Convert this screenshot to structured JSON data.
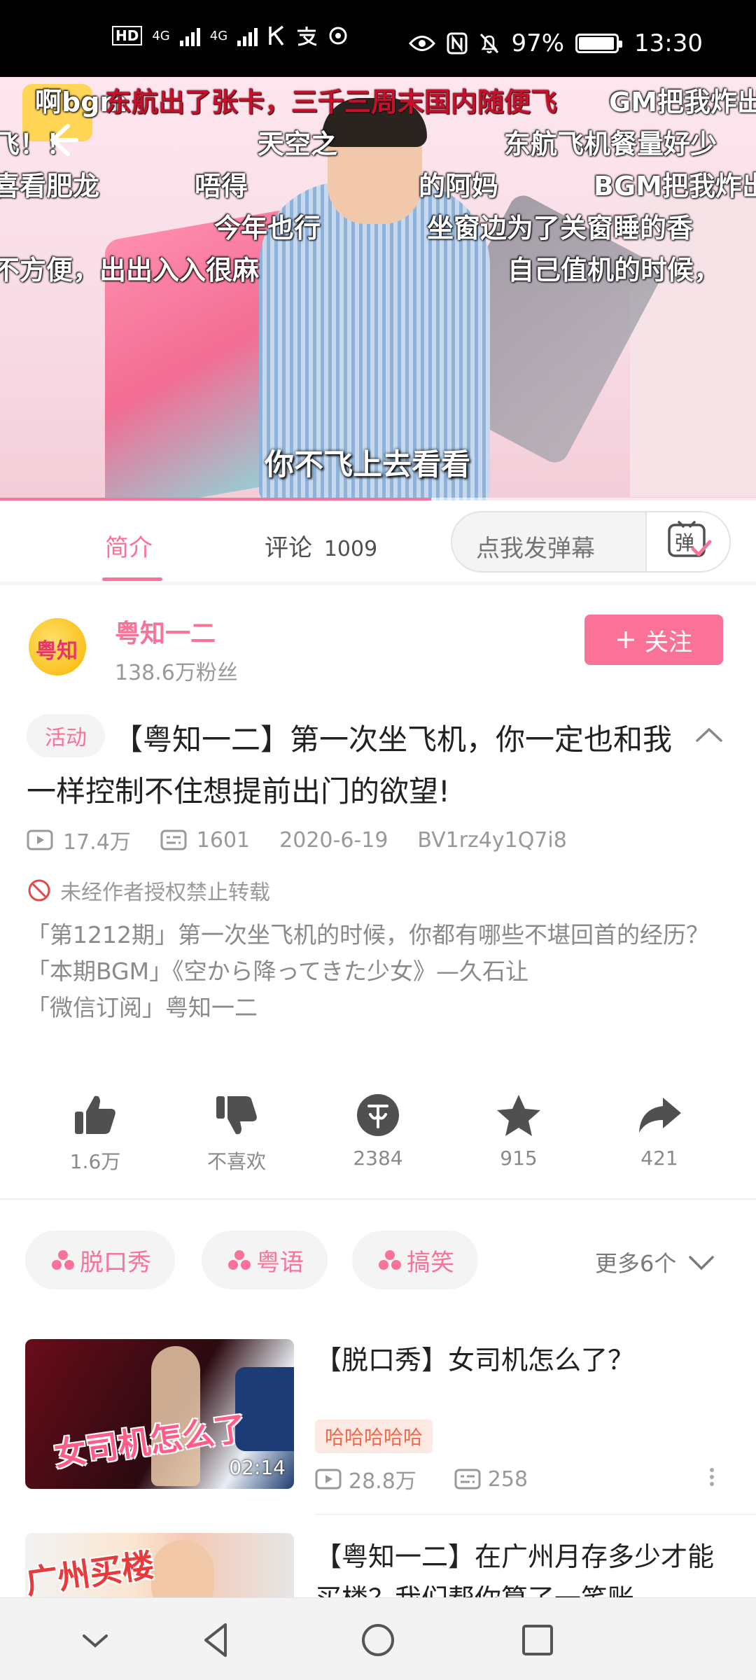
{
  "status_bar": {
    "network_labels": [
      "HD",
      "4G",
      "4G"
    ],
    "battery_percent": "97%",
    "battery_level": 0.97,
    "time": "13:30",
    "icons": [
      "hd-icon",
      "signal-icon",
      "k-icon",
      "alipay-icon",
      "location-icon",
      "eye-icon",
      "nfc-icon",
      "mute-icon",
      "battery-icon"
    ]
  },
  "video": {
    "danmaku": [
      {
        "text": "啊bgm",
        "color": "#ffffff"
      },
      {
        "text": "东航出了张卡，三千三周末国内随便飞",
        "color": "#c4102c"
      },
      {
        "text": "GM把我炸出",
        "color": "#ffffff"
      },
      {
        "text": "飞！！",
        "color": "#ffffff"
      },
      {
        "text": "天空之",
        "color": "#ffffff"
      },
      {
        "text": "东航飞机餐量好少",
        "color": "#ffffff"
      },
      {
        "text": "喜看肥龙",
        "color": "#ffffff"
      },
      {
        "text": "唔得",
        "color": "#ffffff"
      },
      {
        "text": "的阿妈",
        "color": "#ffffff"
      },
      {
        "text": "BGM把我炸出",
        "color": "#ffffff"
      },
      {
        "text": "今年也行",
        "color": "#ffffff"
      },
      {
        "text": "坐窗边为了关窗睡的香",
        "color": "#ffffff"
      },
      {
        "text": "不方便，出出入入很麻",
        "color": "#ffffff"
      },
      {
        "text": "自己值机的时候，",
        "color": "#ffffff"
      }
    ],
    "subtitle": "你不飞上去看看",
    "progress": 0.57,
    "accent": "#fb7299"
  },
  "tabs": {
    "intro": "简介",
    "comments": "评论",
    "comment_count": "1009",
    "danmu_placeholder": "点我发弹幕",
    "danmu_button_icon": "danmaku-toggle-icon",
    "danmu_button_glyph": "弹"
  },
  "uploader": {
    "name": "粤知一二",
    "fans": "138.6万粉丝",
    "follow_label": "关注",
    "avatar_text": "粤知"
  },
  "video_info": {
    "tag": "活动",
    "title": "【粤知一二】第一次坐飞机，你一定也和我一样控制不住想提前出门的欲望!",
    "views": "17.4万",
    "danmaku_count": "1601",
    "date": "2020-6-19",
    "bvid": "BV1rz4y1Q7i8",
    "no_repost": "未经作者授权禁止转载",
    "description": [
      "「第1212期」第一次坐飞机的时候，你都有哪些不堪回首的经历？",
      "「本期BGM」《空から降ってきた少女》—久石让",
      "「微信订阅」粤知一二"
    ]
  },
  "actions": [
    {
      "icon": "like-icon",
      "label": "1.6万"
    },
    {
      "icon": "dislike-icon",
      "label": "不喜欢"
    },
    {
      "icon": "coin-icon",
      "label": "2384"
    },
    {
      "icon": "favorite-icon",
      "label": "915"
    },
    {
      "icon": "share-icon",
      "label": "421"
    }
  ],
  "tags": {
    "items": [
      "脱口秀",
      "粤语",
      "搞笑"
    ],
    "more": "更多6个"
  },
  "related": [
    {
      "title": "【脱口秀】女司机怎么了？",
      "thumb_text": "女司机怎么了",
      "duration": "02:14",
      "badge": "哈哈哈哈哈",
      "views": "28.8万",
      "danmaku": "258"
    },
    {
      "title": "【粤知一二】在广州月存多少才能买楼？我们帮你算了一笔账",
      "thumb_text": "广州买楼"
    }
  ],
  "nav": {
    "icons": [
      "collapse-nav-icon",
      "back-nav-icon",
      "home-nav-icon",
      "recents-nav-icon"
    ]
  }
}
